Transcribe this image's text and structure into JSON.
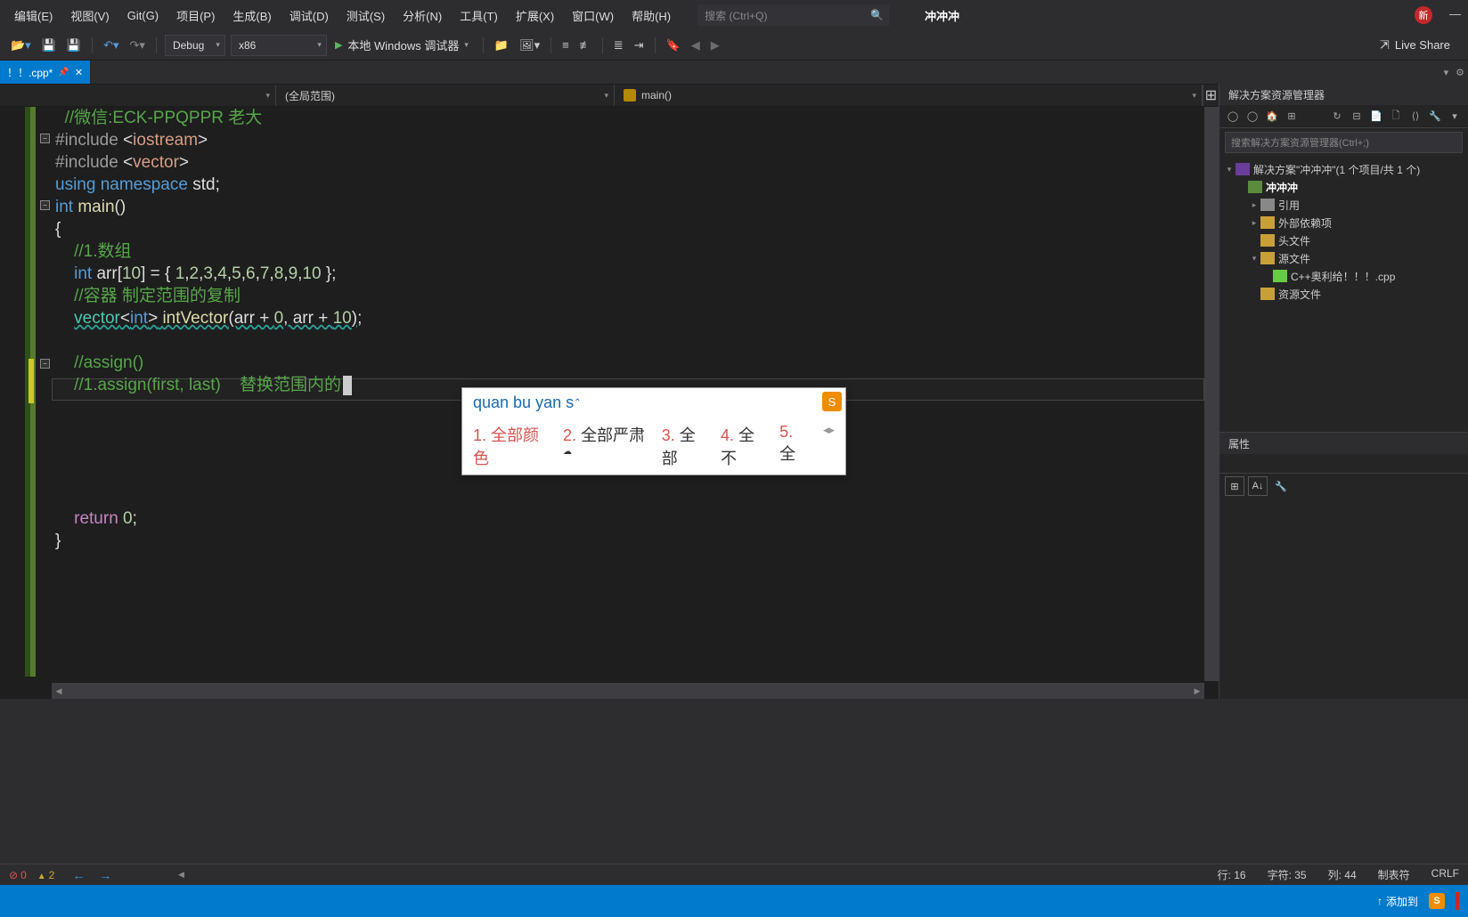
{
  "menu": {
    "items": [
      "编辑(E)",
      "视图(V)",
      "Git(G)",
      "项目(P)",
      "生成(B)",
      "调试(D)",
      "测试(S)",
      "分析(N)",
      "工具(T)",
      "扩展(X)",
      "窗口(W)",
      "帮助(H)"
    ],
    "search_placeholder": "搜索 (Ctrl+Q)",
    "app_title": "冲冲冲",
    "new_badge": "新"
  },
  "toolbar": {
    "config": "Debug",
    "platform": "x86",
    "run_label": "本地 Windows 调试器",
    "liveshare": "Live Share"
  },
  "tab": {
    "name": "！！.cpp*",
    "dirty": true
  },
  "nav": {
    "left": "",
    "middle": "(全局范围)",
    "right": "main()"
  },
  "code": {
    "lines": [
      {
        "t": "comment",
        "text": "//微信:ECK-PPQPPR 老大",
        "indent": 1
      },
      {
        "t": "include1"
      },
      {
        "t": "include2"
      },
      {
        "t": "using"
      },
      {
        "t": "main_sig"
      },
      {
        "t": "brace_open"
      },
      {
        "t": "comment",
        "text": "//1.数组",
        "indent": 2
      },
      {
        "t": "arr_decl"
      },
      {
        "t": "comment",
        "text": "//容器 制定范围的复制",
        "indent": 2
      },
      {
        "t": "vector_decl"
      },
      {
        "t": "blank"
      },
      {
        "t": "comment",
        "text": "//assign()",
        "indent": 2
      },
      {
        "t": "comment_cursor",
        "text": "//1.assign(first, last)    替换范围内的",
        "indent": 2
      },
      {
        "t": "blank"
      },
      {
        "t": "blank"
      },
      {
        "t": "blank"
      },
      {
        "t": "blank"
      },
      {
        "t": "blank"
      },
      {
        "t": "return"
      },
      {
        "t": "brace_close"
      }
    ]
  },
  "ime": {
    "input": "quan bu yan s",
    "candidates": [
      "全部颜色",
      "全部严肃",
      "全部",
      "全不",
      "全"
    ],
    "logo": "S"
  },
  "solution": {
    "title": "解决方案资源管理器",
    "search_placeholder": "搜索解决方案资源管理器(Ctrl+;)",
    "root": "解决方案\"冲冲冲\"(1 个项目/共 1 个)",
    "items": [
      {
        "lvl": 1,
        "label": "冲冲冲",
        "icon": "proj",
        "exp": true,
        "bold": true
      },
      {
        "lvl": 2,
        "label": "引用",
        "icon": "ref",
        "exp": false,
        "arrow": true
      },
      {
        "lvl": 2,
        "label": "外部依赖项",
        "icon": "fold",
        "exp": false,
        "arrow": true
      },
      {
        "lvl": 2,
        "label": "头文件",
        "icon": "fold",
        "exp": false
      },
      {
        "lvl": 2,
        "label": "源文件",
        "icon": "fold",
        "exp": true,
        "arrow": true
      },
      {
        "lvl": 3,
        "label": "C++奥利给！！！.cpp",
        "icon": "cpp"
      },
      {
        "lvl": 2,
        "label": "资源文件",
        "icon": "fold",
        "exp": false
      }
    ]
  },
  "properties": {
    "title": "属性"
  },
  "status": {
    "errors": "0",
    "warnings": "2",
    "line": "行: 16",
    "char": "字符: 35",
    "col": "列: 44",
    "tab": "制表符",
    "eol": "CRLF"
  },
  "bottom": {
    "add": "添加到"
  }
}
